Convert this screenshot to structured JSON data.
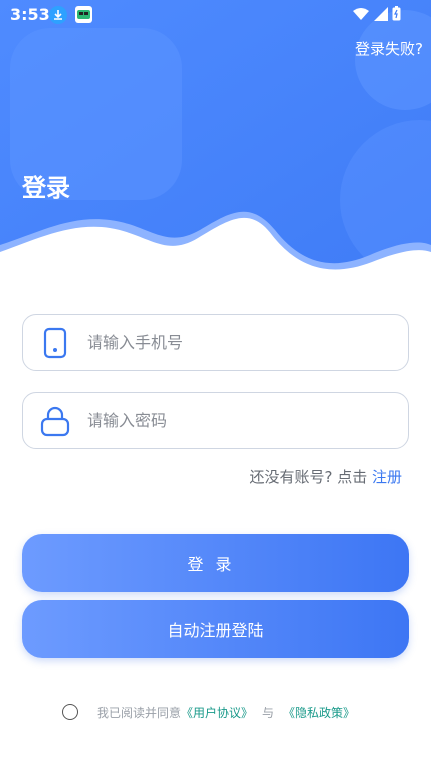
{
  "statusbar": {
    "time": "3:53"
  },
  "header": {
    "fail_link": "登录失败?",
    "title": "登录"
  },
  "form": {
    "phone_placeholder": "请输入手机号",
    "password_placeholder": "请输入密码"
  },
  "register": {
    "prompt": "还没有账号?  点击 ",
    "link": "注册"
  },
  "buttons": {
    "login": "登录",
    "auto_register": "自动注册登陆"
  },
  "agreement": {
    "prefix": "我已阅读并同意",
    "user_agreement": "《用户协议》",
    "and": "与",
    "privacy_policy": "《隐私政策》"
  },
  "colors": {
    "primary": "#3b78f0",
    "gradient_start": "#6d9bff",
    "gradient_end": "#3d76f4",
    "link_teal": "#1a9a8a"
  }
}
